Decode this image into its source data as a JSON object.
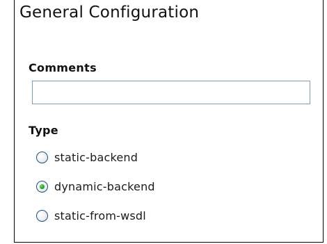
{
  "panel": {
    "title": "General Configuration"
  },
  "form": {
    "comments_label": "Comments",
    "comments_value": "",
    "type_label": "Type",
    "type_options": [
      {
        "label": "static-backend",
        "selected": false
      },
      {
        "label": "dynamic-backend",
        "selected": true
      },
      {
        "label": "static-from-wsdl",
        "selected": false
      }
    ]
  },
  "colors": {
    "panel_border": "#000000",
    "input_border": "#7f9db9",
    "radio_border": "#1c5180",
    "radio_selected": "#21a121"
  }
}
